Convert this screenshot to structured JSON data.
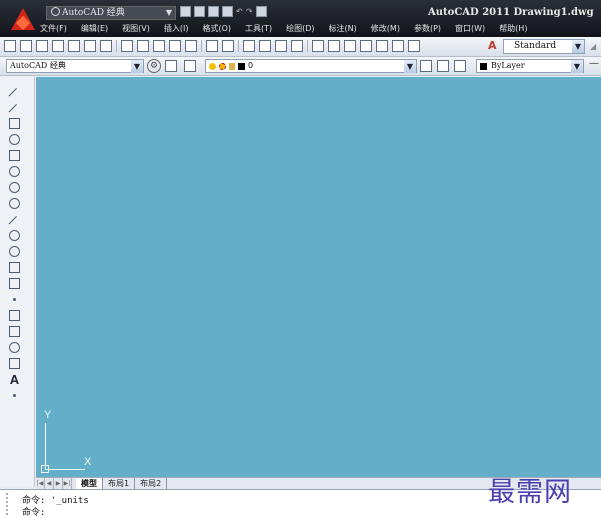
{
  "title_bar": {
    "workspace": "AutoCAD 经典",
    "title": "AutoCAD 2011    Drawing1.dwg"
  },
  "menu": {
    "items": [
      "文件(F)",
      "编辑(E)",
      "视图(V)",
      "插入(I)",
      "格式(O)",
      "工具(T)",
      "绘图(D)",
      "标注(N)",
      "修改(M)",
      "参数(P)",
      "窗口(W)",
      "帮助(H)"
    ]
  },
  "standard_toolbar": {
    "text_style": "Standard"
  },
  "layers_toolbar": {
    "workspace": "AutoCAD 经典",
    "current_layer": "0",
    "color": "ByLayer"
  },
  "layout_tabs": {
    "items": [
      "模型",
      "布局1",
      "布局2"
    ],
    "active": "模型"
  },
  "command_line": {
    "line1": "命令: '_units",
    "line2": "命令:"
  },
  "canvas": {
    "background_color": "#63aec9",
    "ucs_y": "Y",
    "ucs_x": "X"
  },
  "watermark": "最需网"
}
